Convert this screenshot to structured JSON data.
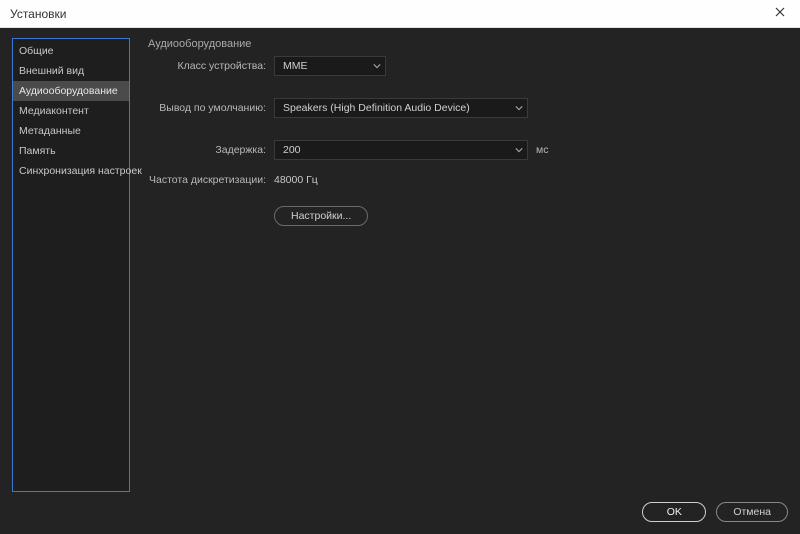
{
  "window": {
    "title": "Установки"
  },
  "sidebar": {
    "items": [
      {
        "label": "Общие"
      },
      {
        "label": "Внешний вид"
      },
      {
        "label": "Аудиооборудование"
      },
      {
        "label": "Медиаконтент"
      },
      {
        "label": "Метаданные"
      },
      {
        "label": "Память"
      },
      {
        "label": "Синхронизация настроек"
      }
    ],
    "selected_index": 2
  },
  "content": {
    "section_title": "Аудиооборудование",
    "device_class": {
      "label": "Класс устройства:",
      "value": "MME"
    },
    "default_output": {
      "label": "Вывод по умолчанию:",
      "value": "Speakers (High Definition Audio Device)"
    },
    "delay": {
      "label": "Задержка:",
      "value": "200",
      "unit": "мс"
    },
    "sample_rate": {
      "label": "Частота дискретизации:",
      "value": "48000 Гц"
    },
    "settings_button": "Настройки..."
  },
  "footer": {
    "ok": "OK",
    "cancel": "Отмена"
  }
}
